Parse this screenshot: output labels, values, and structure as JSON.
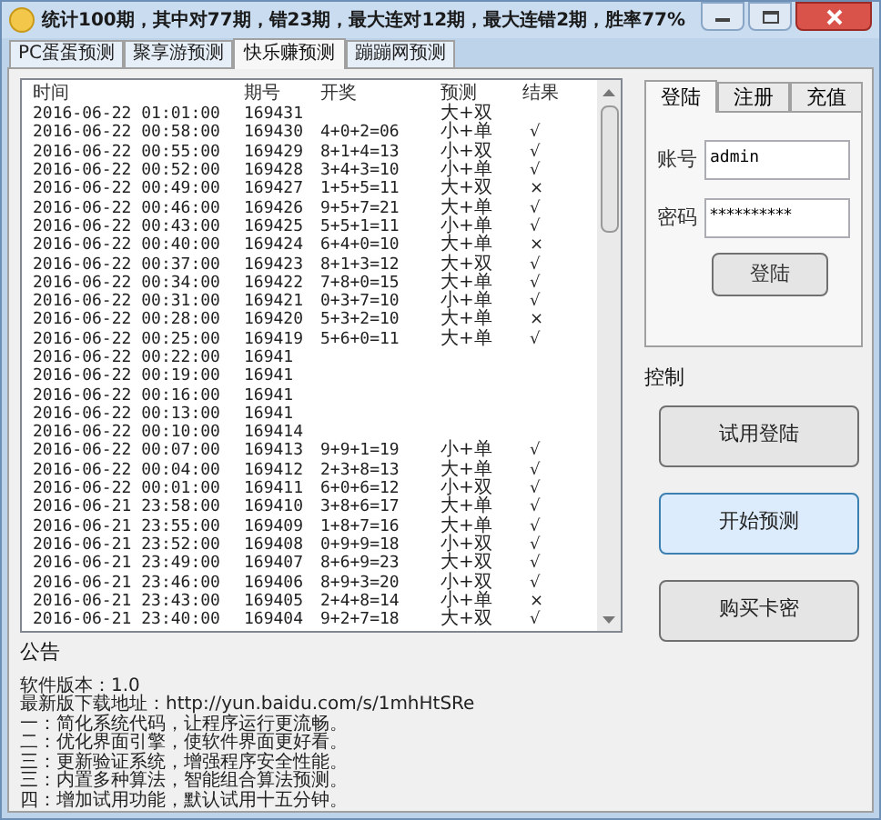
{
  "window": {
    "title": "统计100期，其中对77期，错23期，最大连对12期，最大连错2期，胜率77%"
  },
  "tabs": [
    {
      "label": "PC蛋蛋预测",
      "selected": false
    },
    {
      "label": "聚享游预测",
      "selected": false
    },
    {
      "label": "快乐赚预测",
      "selected": true
    },
    {
      "label": "蹦蹦网预测",
      "selected": false
    }
  ],
  "table": {
    "columns": [
      "时间",
      "期号",
      "开奖",
      "预测",
      "结果"
    ],
    "rows": [
      [
        "2016-06-22 01:01:00",
        "169431",
        "",
        "大+双",
        ""
      ],
      [
        "2016-06-22 00:58:00",
        "169430",
        "4+0+2=06",
        "小+单",
        "√"
      ],
      [
        "2016-06-22 00:55:00",
        "169429",
        "8+1+4=13",
        "小+双",
        "√"
      ],
      [
        "2016-06-22 00:52:00",
        "169428",
        "3+4+3=10",
        "小+单",
        "√"
      ],
      [
        "2016-06-22 00:49:00",
        "169427",
        "1+5+5=11",
        "大+双",
        "×"
      ],
      [
        "2016-06-22 00:46:00",
        "169426",
        "9+5+7=21",
        "大+单",
        "√"
      ],
      [
        "2016-06-22 00:43:00",
        "169425",
        "5+5+1=11",
        "小+单",
        "√"
      ],
      [
        "2016-06-22 00:40:00",
        "169424",
        "6+4+0=10",
        "大+单",
        "×"
      ],
      [
        "2016-06-22 00:37:00",
        "169423",
        "8+1+3=12",
        "大+双",
        "√"
      ],
      [
        "2016-06-22 00:34:00",
        "169422",
        "7+8+0=15",
        "大+单",
        "√"
      ],
      [
        "2016-06-22 00:31:00",
        "169421",
        "0+3+7=10",
        "小+单",
        "√"
      ],
      [
        "2016-06-22 00:28:00",
        "169420",
        "5+3+2=10",
        "大+单",
        "×"
      ],
      [
        "2016-06-22 00:25:00",
        "169419",
        "5+6+0=11",
        "大+单",
        "√"
      ],
      [
        "2016-06-22 00:22:00",
        "16941",
        "",
        "",
        ""
      ],
      [
        "2016-06-22 00:19:00",
        "16941",
        "",
        "",
        ""
      ],
      [
        "2016-06-22 00:16:00",
        "16941",
        "",
        "",
        ""
      ],
      [
        "2016-06-22 00:13:00",
        "16941",
        "",
        "",
        ""
      ],
      [
        "2016-06-22 00:10:00",
        "169414",
        "",
        "",
        ""
      ],
      [
        "2016-06-22 00:07:00",
        "169413",
        "9+9+1=19",
        "小+单",
        "√"
      ],
      [
        "2016-06-22 00:04:00",
        "169412",
        "2+3+8=13",
        "大+单",
        "√"
      ],
      [
        "2016-06-22 00:01:00",
        "169411",
        "6+0+6=12",
        "小+双",
        "√"
      ],
      [
        "2016-06-21 23:58:00",
        "169410",
        "3+8+6=17",
        "大+单",
        "√"
      ],
      [
        "2016-06-21 23:55:00",
        "169409",
        "1+8+7=16",
        "大+单",
        "√"
      ],
      [
        "2016-06-21 23:52:00",
        "169408",
        "0+9+9=18",
        "小+双",
        "√"
      ],
      [
        "2016-06-21 23:49:00",
        "169407",
        "8+6+9=23",
        "大+双",
        "√"
      ],
      [
        "2016-06-21 23:46:00",
        "169406",
        "8+9+3=20",
        "小+双",
        "√"
      ],
      [
        "2016-06-21 23:43:00",
        "169405",
        "2+4+8=14",
        "小+单",
        "×"
      ],
      [
        "2016-06-21 23:40:00",
        "169404",
        "9+2+7=18",
        "大+双",
        "√"
      ]
    ]
  },
  "account_tabs": [
    {
      "label": "登陆",
      "selected": true
    },
    {
      "label": "注册",
      "selected": false
    },
    {
      "label": "充值",
      "selected": false
    }
  ],
  "login": {
    "account_label": "账号",
    "account": "admin",
    "password_label": "密码",
    "password": "**********",
    "button": "登陆"
  },
  "control": {
    "label": "控制",
    "buttons": [
      {
        "label": "试用登陆",
        "focused": false
      },
      {
        "label": "开始预测",
        "focused": true
      },
      {
        "label": "购买卡密",
        "focused": false
      }
    ]
  },
  "notice": {
    "label": "公告",
    "lines": [
      "软件版本：1.0",
      "最新版下载地址：http://yun.baidu.com/s/1mhHtSRe",
      "一：简化系统代码，让程序运行更流畅。",
      "二：优化界面引擎，使软件界面更好看。",
      "三：更新验证系统，增强程序安全性能。",
      "三：内置多种算法，智能组合算法预测。",
      "四：增加试用功能，默认试用十五分钟。"
    ]
  }
}
